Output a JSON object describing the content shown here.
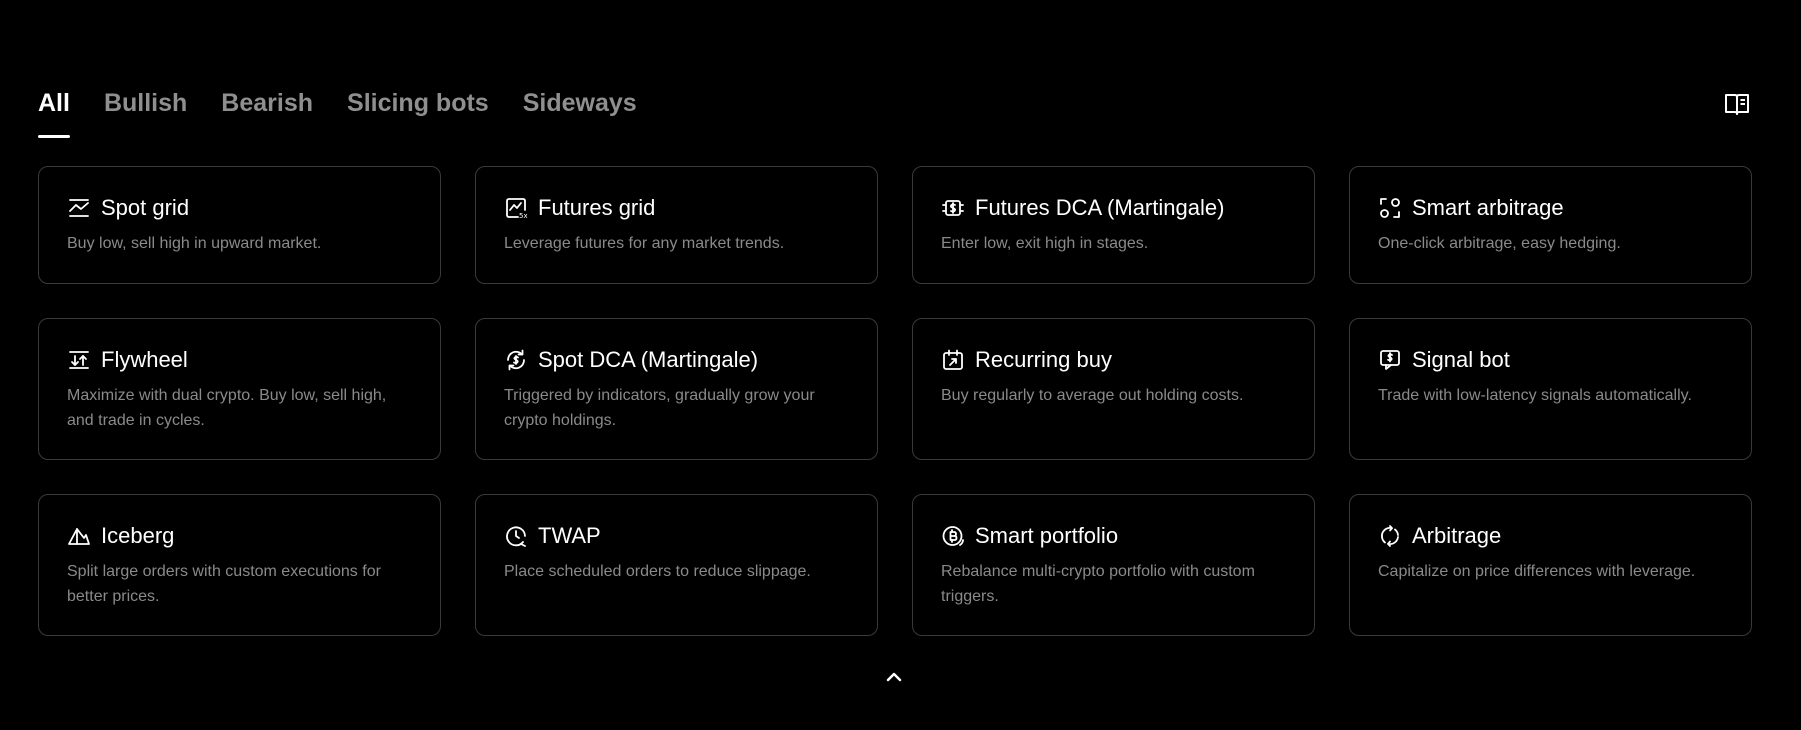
{
  "tabs": [
    {
      "label": "All",
      "active": true
    },
    {
      "label": "Bullish",
      "active": false
    },
    {
      "label": "Bearish",
      "active": false
    },
    {
      "label": "Slicing bots",
      "active": false
    },
    {
      "label": "Sideways",
      "active": false
    }
  ],
  "toolbar": {
    "guide_icon": "book-icon"
  },
  "cards": [
    {
      "title": "Spot grid",
      "desc": "Buy low, sell high in upward market.",
      "icon": "spot-grid-icon"
    },
    {
      "title": "Futures grid",
      "desc": "Leverage futures for any market trends.",
      "icon": "futures-grid-icon"
    },
    {
      "title": "Futures DCA (Martingale)",
      "desc": "Enter low, exit high in stages.",
      "icon": "futures-dca-icon"
    },
    {
      "title": "Smart arbitrage",
      "desc": "One-click arbitrage, easy hedging.",
      "icon": "smart-arbitrage-icon"
    },
    {
      "title": "Flywheel",
      "desc": "Maximize with dual crypto. Buy low, sell high, and trade in cycles.",
      "icon": "flywheel-icon"
    },
    {
      "title": "Spot DCA (Martingale)",
      "desc": "Triggered by indicators, gradually grow your crypto holdings.",
      "icon": "spot-dca-icon"
    },
    {
      "title": "Recurring buy",
      "desc": "Buy regularly to average out holding costs.",
      "icon": "recurring-buy-icon"
    },
    {
      "title": "Signal bot",
      "desc": "Trade with low-latency signals automatically.",
      "icon": "signal-bot-icon"
    },
    {
      "title": "Iceberg",
      "desc": "Split large orders with custom executions for better prices.",
      "icon": "iceberg-icon"
    },
    {
      "title": "TWAP",
      "desc": "Place scheduled orders to reduce slippage.",
      "icon": "twap-icon"
    },
    {
      "title": "Smart portfolio",
      "desc": "Rebalance multi-crypto portfolio with custom triggers.",
      "icon": "smart-portfolio-icon"
    },
    {
      "title": "Arbitrage",
      "desc": "Capitalize on price differences with leverage.",
      "icon": "arbitrage-icon"
    }
  ],
  "footer": {
    "collapse_icon": "chevron-up-icon"
  }
}
